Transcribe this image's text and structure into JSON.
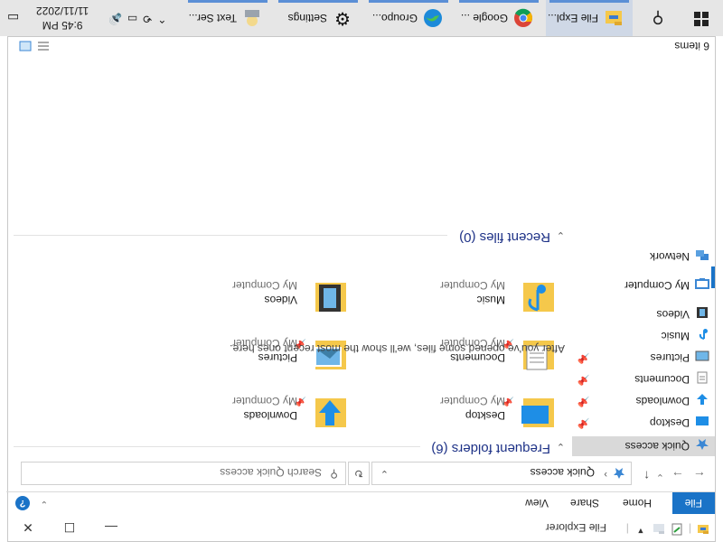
{
  "window": {
    "title": "File Explorer",
    "ribbon_tabs": [
      "File",
      "Home",
      "Share",
      "View"
    ],
    "help_glyph": "?"
  },
  "address": {
    "path": "Quick access",
    "search_placeholder": "Search Quick access"
  },
  "nav": {
    "quick_access": "Quick access",
    "items": [
      {
        "label": "Desktop",
        "icon": "desktop-icon",
        "pinned": true
      },
      {
        "label": "Downloads",
        "icon": "downloads-icon",
        "pinned": true
      },
      {
        "label": "Documents",
        "icon": "documents-icon",
        "pinned": true
      },
      {
        "label": "Pictures",
        "icon": "pictures-icon",
        "pinned": true
      },
      {
        "label": "Music",
        "icon": "music-icon",
        "pinned": false
      },
      {
        "label": "Videos",
        "icon": "videos-icon",
        "pinned": false
      }
    ],
    "my_computer": "My Computer",
    "network": "Network"
  },
  "content": {
    "frequent_header": "Frequent folders (6)",
    "recent_header": "Recent files (0)",
    "empty_message": "After you've opened some files, we'll show the most recent ones here.",
    "folders": [
      {
        "name": "Desktop",
        "location": "My Computer",
        "icon": "desktop-folder-icon"
      },
      {
        "name": "Downloads",
        "location": "My Computer",
        "icon": "downloads-folder-icon"
      },
      {
        "name": "Documents",
        "location": "My Computer",
        "icon": "documents-folder-icon"
      },
      {
        "name": "Pictures",
        "location": "My Computer",
        "icon": "pictures-folder-icon"
      },
      {
        "name": "Music",
        "location": "My Computer",
        "icon": "music-folder-icon"
      },
      {
        "name": "Videos",
        "location": "My Computer",
        "icon": "videos-folder-icon"
      }
    ]
  },
  "status": {
    "items": "6 items"
  },
  "taskbar": {
    "apps": [
      {
        "label": "File Expl...",
        "icon": "file-explorer-icon"
      },
      {
        "label": "Google ...",
        "icon": "chrome-icon"
      },
      {
        "label": "Groupo...",
        "icon": "edge-icon"
      },
      {
        "label": "Settings",
        "icon": "settings-icon"
      },
      {
        "label": "Text Ser...",
        "icon": "text-services-icon"
      }
    ],
    "time": "9:45 PM",
    "date": "11/11/2022"
  },
  "colors": {
    "accent": "#1a73c7",
    "group_header": "#1e3287",
    "folder_yellow": "#f5c84b",
    "taskbar": "#e6e6e6"
  }
}
